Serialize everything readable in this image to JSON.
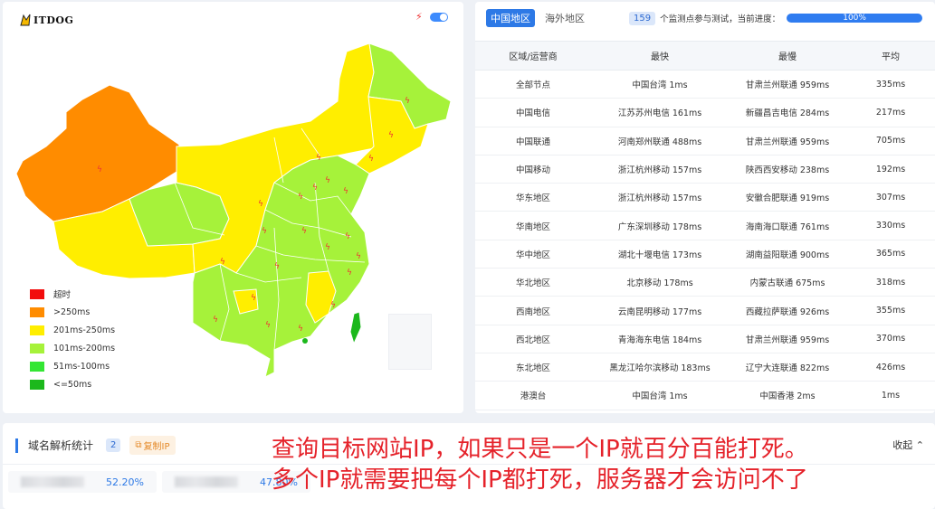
{
  "map": {
    "logo_text": "ITDOG",
    "legend": [
      {
        "label": "超时",
        "color": "#f20d0d"
      },
      {
        "label": ">250ms",
        "color": "#ff8c00"
      },
      {
        "label": "201ms-250ms",
        "color": "#ffee00"
      },
      {
        "label": "101ms-200ms",
        "color": "#a6f23a"
      },
      {
        "label": "51ms-100ms",
        "color": "#33e633"
      },
      {
        "label": "<=50ms",
        "color": "#1cb81c"
      }
    ],
    "region_colors": {
      "xinjiang": "#ff8c00",
      "xizang": "#ffee00",
      "qinghai": "#a6f23a",
      "north": "#ffee00",
      "east": "#a6f23a",
      "taiwan": "#1cb81c"
    }
  },
  "table": {
    "tabs": [
      "中国地区",
      "海外地区"
    ],
    "active_tab": 0,
    "node_count": "159",
    "progress_label": "个监测点参与测试，当前进度：",
    "progress": 1.0,
    "progress_text": "100%",
    "headers": [
      "区域/运营商",
      "最快",
      "最慢",
      "平均"
    ],
    "rows": [
      [
        "全部节点",
        "中国台湾 1ms",
        "甘肃兰州联通 959ms",
        "335ms"
      ],
      [
        "中国电信",
        "江苏苏州电信 161ms",
        "新疆昌吉电信 284ms",
        "217ms"
      ],
      [
        "中国联通",
        "河南郑州联通 488ms",
        "甘肃兰州联通 959ms",
        "705ms"
      ],
      [
        "中国移动",
        "浙江杭州移动 157ms",
        "陕西西安移动 238ms",
        "192ms"
      ],
      [
        "华东地区",
        "浙江杭州移动 157ms",
        "安徽合肥联通 919ms",
        "307ms"
      ],
      [
        "华南地区",
        "广东深圳移动 178ms",
        "海南海口联通 761ms",
        "330ms"
      ],
      [
        "华中地区",
        "湖北十堰电信 173ms",
        "湖南益阳联通 900ms",
        "365ms"
      ],
      [
        "华北地区",
        "北京移动 178ms",
        "内蒙古联通 675ms",
        "318ms"
      ],
      [
        "西南地区",
        "云南昆明移动 177ms",
        "西藏拉萨联通 926ms",
        "355ms"
      ],
      [
        "西北地区",
        "青海海东电信 184ms",
        "甘肃兰州联通 959ms",
        "370ms"
      ],
      [
        "东北地区",
        "黑龙江哈尔滨移动 183ms",
        "辽宁大连联通 822ms",
        "426ms"
      ],
      [
        "港澳台",
        "中国台湾 1ms",
        "中国香港 2ms",
        "1ms"
      ]
    ]
  },
  "dns": {
    "title": "域名解析统计",
    "count": "2",
    "copy_label": "复制IP",
    "collapse_label": "收起",
    "ips": [
      {
        "percent": "52.20%"
      },
      {
        "percent": "47.80%"
      }
    ]
  },
  "overlay": {
    "line1": "查询目标网站IP，如果只是一个IP就百分百能打死。",
    "line2": "多个IP就需要把每个IP都打死，服务器才会访问不了"
  }
}
